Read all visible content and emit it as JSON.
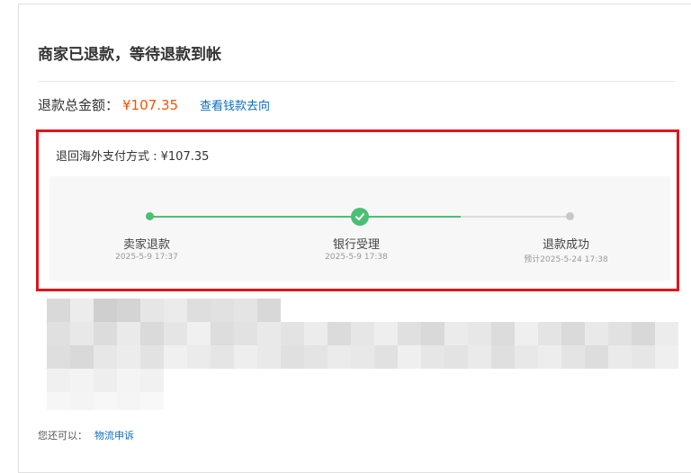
{
  "header": {
    "title": "商家已退款，等待退款到帐"
  },
  "refund": {
    "total_label": "退款总金额：",
    "total_amount": "¥107.35",
    "money_flow_link": "查看钱款去向"
  },
  "overseas": {
    "text": "退回海外支付方式 : ¥107.35"
  },
  "progress": {
    "steps": [
      {
        "label": "卖家退款",
        "time": "2025-5-9 17:37",
        "status": "done"
      },
      {
        "label": "银行受理",
        "time": "2025-5-9 17:38",
        "status": "current"
      },
      {
        "label": "退款成功",
        "time": "预计2025-5-24 17:38",
        "status": "pending"
      }
    ]
  },
  "footer": {
    "prompt": "您还可以：",
    "appeal_link": "物流申诉"
  },
  "colors": {
    "accent_green": "#4bbf73",
    "price_orange": "#ff5000",
    "link_blue": "#0a6ebd",
    "highlight_red": "#e0151c"
  }
}
